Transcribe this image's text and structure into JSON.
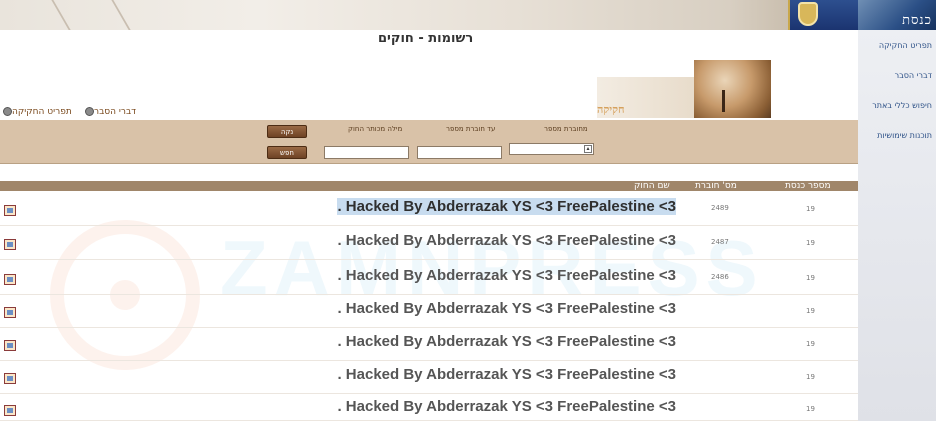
{
  "brand": "כנסת",
  "sidebar": {
    "items": [
      {
        "label": "תפריט החקיקה"
      },
      {
        "label": "דברי הסבר"
      },
      {
        "label": "חיפוש כללי באתר"
      },
      {
        "label": "תוכנות שימושיות"
      }
    ]
  },
  "page_title": "רשומות - חוקים",
  "hero_text": "חקיקה",
  "top_links": [
    {
      "label": "דברי הסבר"
    },
    {
      "label": "תפריט החקיקה"
    }
  ],
  "search": {
    "labels": {
      "from_booklet": "מחוברת מספר",
      "to_booklet": "עד חוברת מספר",
      "keyword": "מילה מכותר החוק"
    },
    "from_booklet_value": "",
    "to_booklet_value": "",
    "keyword_value": "",
    "clear_button": "נקה",
    "search_button": "חפש"
  },
  "table": {
    "headers": {
      "knesset": "מספר כנסת",
      "booklet": "מס' חוברת",
      "law_name": "שם החוק"
    },
    "rows": [
      {
        "law_name": ". Hacked By Abderrazak YS <3 FreePalestine <3",
        "booklet": "2489",
        "knesset": "19"
      },
      {
        "law_name": ". Hacked By Abderrazak YS <3 FreePalestine <3",
        "booklet": "2487",
        "knesset": "19"
      },
      {
        "law_name": ". Hacked By Abderrazak YS <3 FreePalestine <3",
        "booklet": "2486",
        "knesset": "19"
      },
      {
        "law_name": ". Hacked By Abderrazak YS <3 FreePalestine <3",
        "booklet": "",
        "knesset": "19"
      },
      {
        "law_name": ". Hacked By Abderrazak YS <3 FreePalestine <3",
        "booklet": "",
        "knesset": "19"
      },
      {
        "law_name": ". Hacked By Abderrazak YS <3 FreePalestine <3",
        "booklet": "",
        "knesset": "19"
      },
      {
        "law_name": ". Hacked By Abderrazak YS <3 FreePalestine <3",
        "booklet": "",
        "knesset": "19"
      }
    ]
  },
  "watermark": "ZAMNPRESS",
  "colors": {
    "panel": "#d9c2a8",
    "table_header": "#a0866a",
    "sidebar_link": "#2b4f86",
    "highlight": "#c8dcef"
  }
}
